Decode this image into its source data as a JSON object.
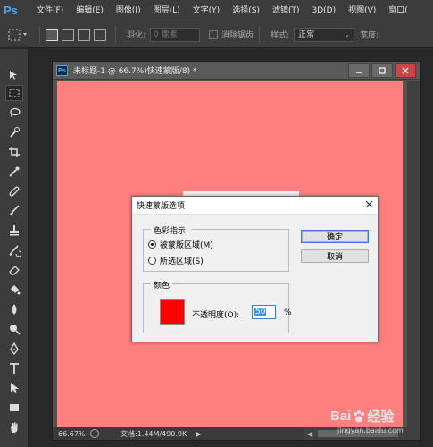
{
  "app": {
    "logo": "Ps"
  },
  "menubar": {
    "items": [
      "文件(F)",
      "编辑(E)",
      "图像(I)",
      "图层(L)",
      "文字(Y)",
      "选择(S)",
      "滤镜(T)",
      "3D(D)",
      "视图(V)",
      "窗口("
    ]
  },
  "options": {
    "feather_label": "羽化:",
    "feather_value": "0 像素",
    "antialias_label": "消除锯齿",
    "style_label": "样式:",
    "style_value": "正常",
    "width_label": "宽度:"
  },
  "document": {
    "title": "未标题-1 @ 66.7%(快速蒙版/8) *",
    "canvas_color": "#ff7f7f",
    "zoom": "66.67%",
    "doc_info": "文档:1.44M/490.9K"
  },
  "dialog": {
    "title": "快速蒙版选项",
    "color_indicates_label": "色彩指示:",
    "radio_masked": "被蒙版区域(M)",
    "radio_selected": "所选区域(S)",
    "color_group_label": "颜色",
    "swatch_color": "#ff0000",
    "opacity_label": "不透明度(O):",
    "opacity_value": "50",
    "opacity_unit": "%",
    "ok_label": "确定",
    "cancel_label": "取消"
  },
  "watermark": {
    "brand_left": "Bai",
    "brand_right": "经验",
    "url": "jingyan.baidu.com"
  }
}
